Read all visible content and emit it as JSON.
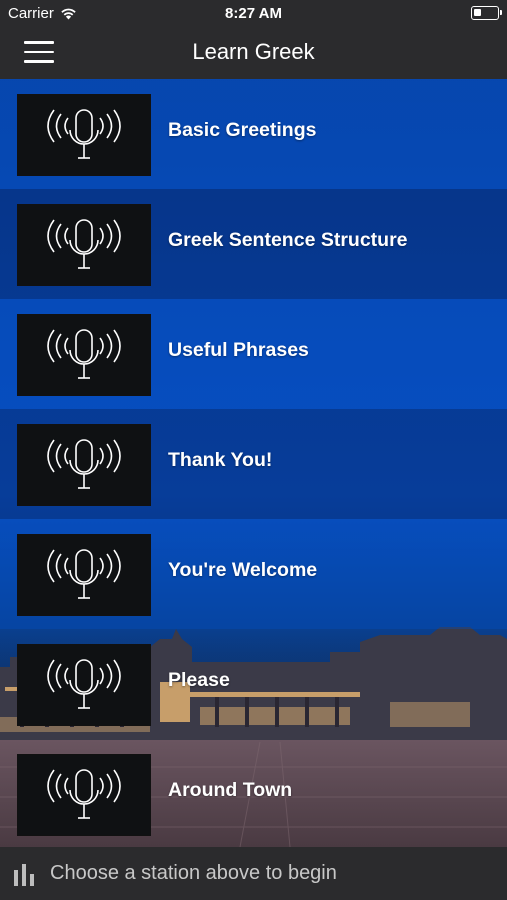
{
  "status": {
    "carrier": "Carrier",
    "time": "8:27 AM",
    "battery_level": 0.3
  },
  "nav": {
    "title": "Learn Greek",
    "menu_icon": "hamburger-menu-icon"
  },
  "lessons": [
    {
      "label": "Basic Greetings",
      "icon": "microphone-broadcast-icon"
    },
    {
      "label": "Greek Sentence Structure",
      "icon": "microphone-broadcast-icon"
    },
    {
      "label": "Useful Phrases",
      "icon": "microphone-broadcast-icon"
    },
    {
      "label": "Thank You!",
      "icon": "microphone-broadcast-icon"
    },
    {
      "label": "You're Welcome",
      "icon": "microphone-broadcast-icon"
    },
    {
      "label": "Please",
      "icon": "microphone-broadcast-icon"
    },
    {
      "label": "Around Town",
      "icon": "microphone-broadcast-icon"
    }
  ],
  "footer": {
    "message": "Choose a station above to begin",
    "icon": "equalizer-bars-icon"
  },
  "colors": {
    "bar_background": "#2b2b2d",
    "list_blue": "#0b4fbe"
  }
}
